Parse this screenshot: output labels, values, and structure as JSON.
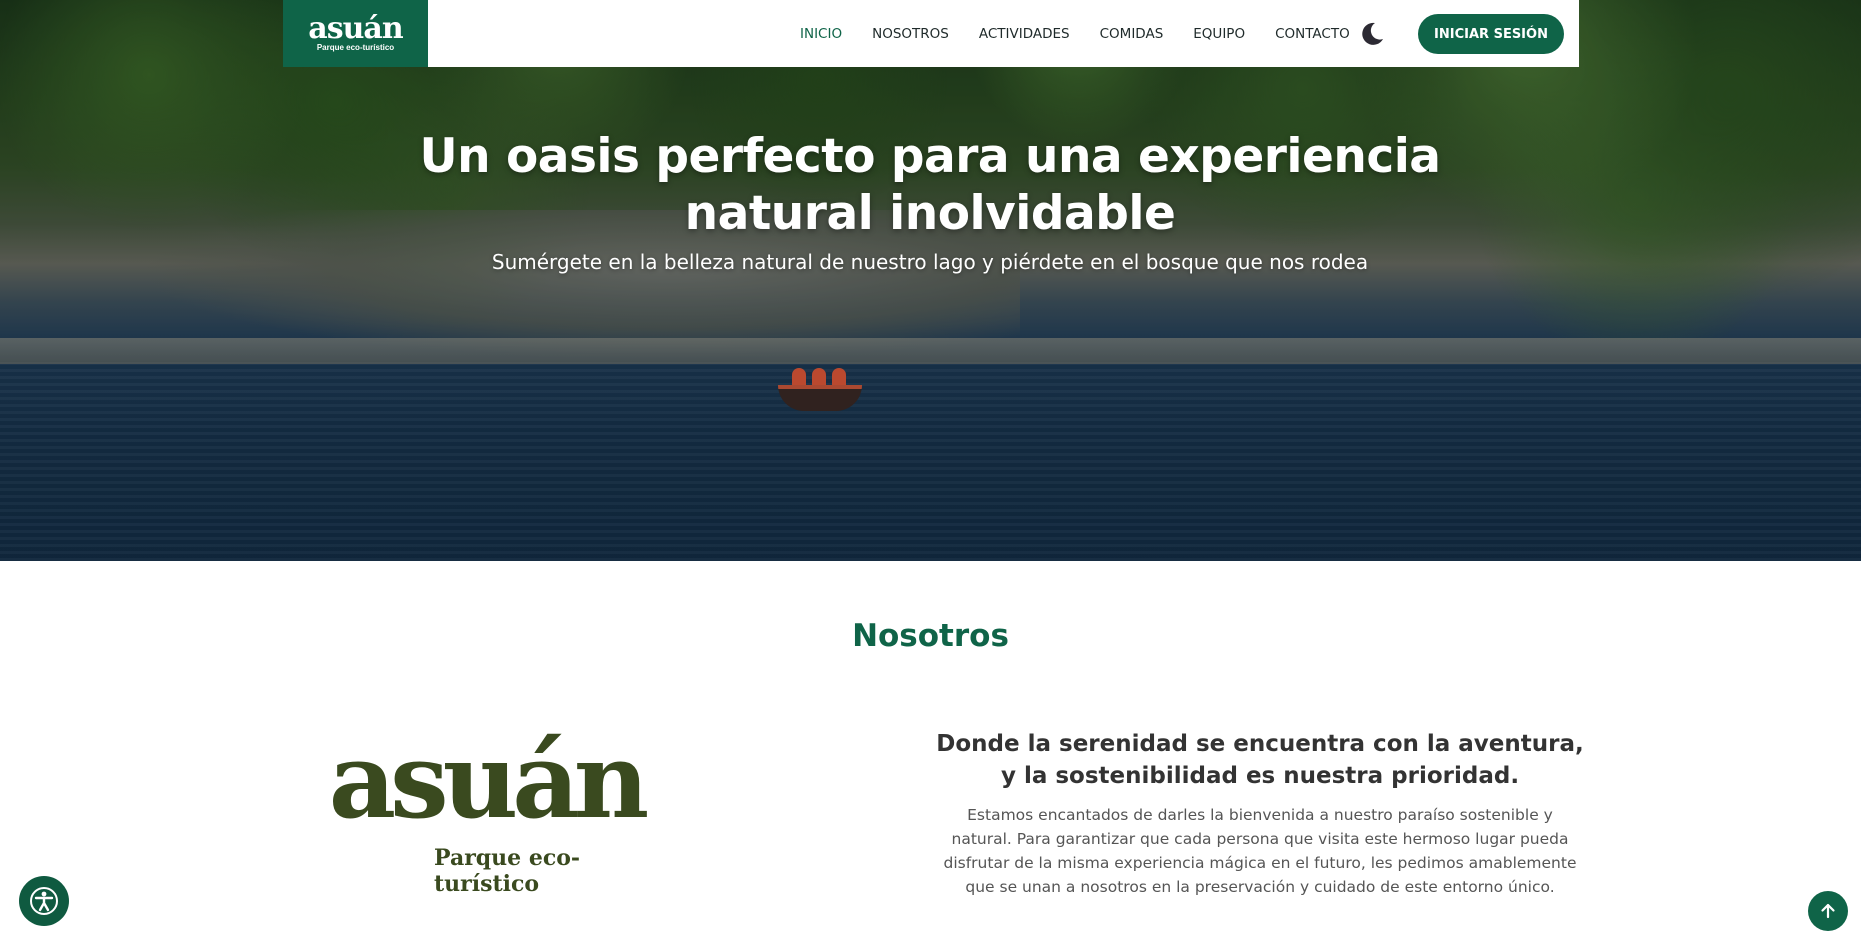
{
  "brand": {
    "name": "asuán",
    "tagline": "Parque eco-turístico"
  },
  "nav": {
    "items": [
      "INICIO",
      "NOSOTROS",
      "ACTIVIDADES",
      "COMIDAS",
      "EQUIPO",
      "CONTACTO"
    ],
    "active": "INICIO",
    "theme_toggle_icon": "moon-icon",
    "login_label": "INICIAR SESIÓN"
  },
  "hero": {
    "title": "Un oasis perfecto para una experiencia natural inolvidable",
    "subtitle": "Sumérgete en la belleza natural de nuestro lago y piérdete en el bosque que nos rodea"
  },
  "about": {
    "section_title": "Nosotros",
    "heading": "Donde la serenidad se encuentra con la aventura, y la sostenibilidad es nuestra prioridad.",
    "body": "Estamos encantados de darles la bienvenida a nuestro paraíso sostenible y natural. Para garantizar que cada persona que visita este hermoso lugar pueda disfrutar de la misma experiencia mágica en el futuro, les pedimos amablemente que se unan a nosotros en la preservación y cuidado de este entorno único."
  },
  "floating": {
    "accessibility_icon": "accessibility-icon",
    "scroll_top_icon": "arrow-up-icon"
  },
  "colors": {
    "primary": "#0f6448",
    "logo_text": "#3a4a1f",
    "nav_text": "#1f2a2a"
  }
}
